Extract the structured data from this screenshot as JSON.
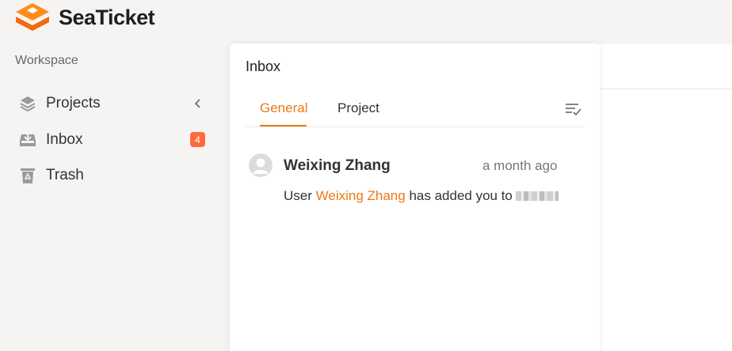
{
  "app": {
    "name": "SeaTicket",
    "logo_icon": "seaticket-logo-icon",
    "brand_color": "#ff7d1a",
    "accent_color": "#ec7817"
  },
  "sidebar": {
    "section_label": "Workspace",
    "items": [
      {
        "label": "Projects",
        "icon": "layers-icon",
        "trailing": "chevron-left-icon"
      },
      {
        "label": "Inbox",
        "icon": "inbox-icon",
        "badge": "4",
        "badge_color": "#ff6a3d"
      },
      {
        "label": "Trash",
        "icon": "trash-icon"
      }
    ]
  },
  "inbox": {
    "title": "Inbox",
    "tabs": [
      {
        "label": "General",
        "active": true
      },
      {
        "label": "Project",
        "active": false
      }
    ],
    "filter_icon": "mark-read-list-icon",
    "notifications": [
      {
        "avatar_icon": "default-avatar-icon",
        "sender": "Weixing Zhang",
        "time": "a month ago",
        "message_prefix": "User ",
        "message_link": "Weixing Zhang",
        "message_suffix": " has added you to"
      }
    ]
  }
}
